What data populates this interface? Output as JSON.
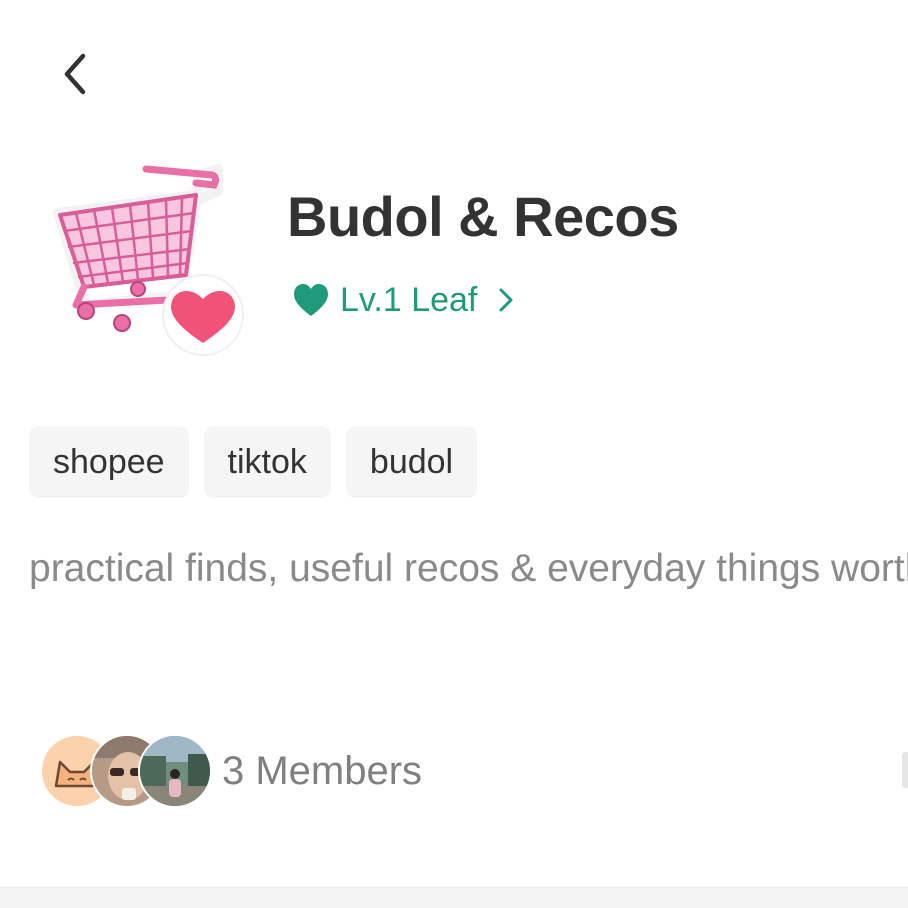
{
  "header": {
    "back_icon": "chevron-left-icon"
  },
  "group": {
    "avatar_icon": "shopping-cart-heart-icon",
    "title": "Budol & Recos",
    "level": {
      "icon": "heart-icon",
      "label": "Lv.1 Leaf",
      "chevron_icon": "chevron-right-icon",
      "color": "#1f9a7a"
    }
  },
  "tags": [
    {
      "label": "shopee"
    },
    {
      "label": "tiktok"
    },
    {
      "label": "budol"
    }
  ],
  "description": "practical finds, useful recos & everyday things worth sharin g",
  "members": {
    "label": "3 Members",
    "avatars": [
      "cat-avatar",
      "sunglasses-avatar",
      "outdoor-photo-avatar"
    ]
  },
  "colors": {
    "accent": "#1f9a7a",
    "heart_pink": "#f25277",
    "cart_pink": "#e96fa6"
  }
}
